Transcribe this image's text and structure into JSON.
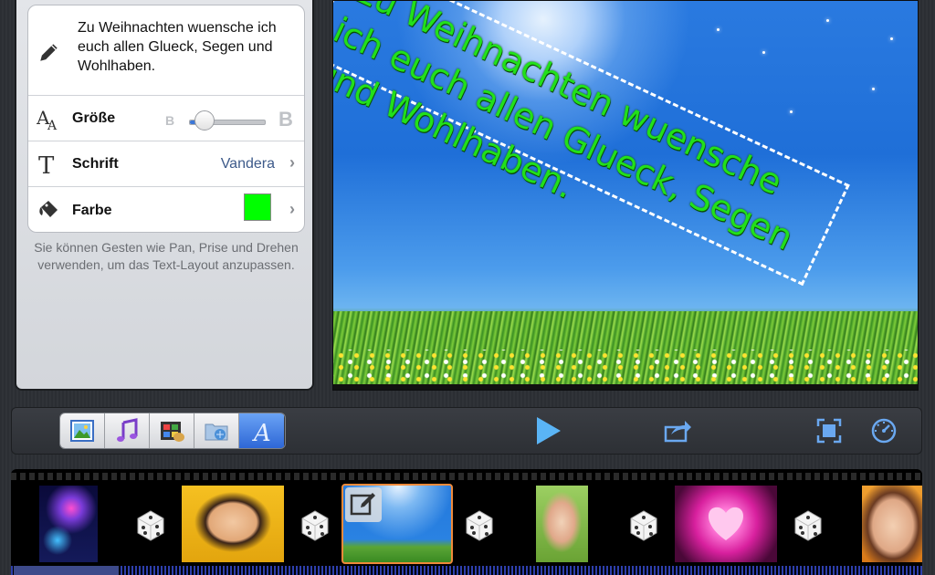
{
  "text_editor": {
    "text_value": "Zu Weihnachten wuensche ich euch allen Glueck, Segen und Wohlhaben.",
    "size_label": "Größe",
    "size_level": 0.2,
    "font_label": "Schrift",
    "font_value": "Vandera",
    "color_label": "Farbe",
    "color_value": "#00ff00",
    "help_text": "Sie können Gesten wie Pan, Prise und Drehen verwenden, um das Text-Layout anzupassen."
  },
  "preview": {
    "overlay_text": "Zu Weihnachten wuensche ich euch allen Glueck, Segen und Wohlhaben.",
    "overlay_color": "#22e01a"
  },
  "toolbar": {
    "tools": [
      "photos-icon",
      "music-icon",
      "film-icon",
      "folder-icon",
      "text-icon"
    ],
    "active_tool": "text-icon",
    "actions": [
      "play-icon",
      "share-icon",
      "fullscreen-icon",
      "speed-icon"
    ]
  },
  "timeline": {
    "clips": [
      "fireworks",
      "dice",
      "woman-smiling",
      "dice",
      "sky-grass",
      "dice",
      "child-meadow",
      "dice",
      "pink-heart",
      "dice",
      "woman-portrait"
    ],
    "selected_clip": "sky-grass"
  }
}
